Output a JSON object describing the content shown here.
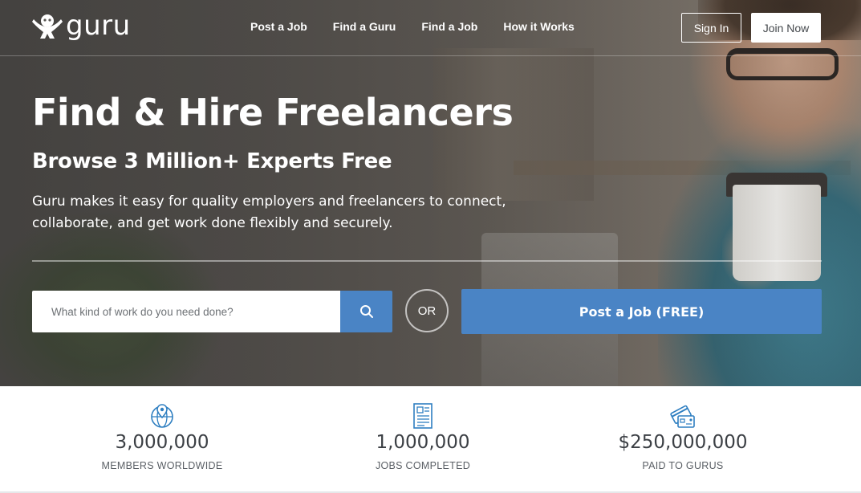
{
  "brand": {
    "logo_text": "guru"
  },
  "nav": {
    "links": [
      {
        "label": "Post a Job"
      },
      {
        "label": "Find a Guru"
      },
      {
        "label": "Find a Job"
      },
      {
        "label": "How it Works"
      }
    ],
    "sign_in": "Sign In",
    "join_now": "Join Now"
  },
  "hero": {
    "title": "Find & Hire Freelancers",
    "subtitle": "Browse 3 Million+ Experts Free",
    "description": "Guru makes it easy for quality employers and freelancers to connect, collaborate, and get work done flexibly and securely.",
    "search": {
      "placeholder": "What kind of work do you need done?",
      "value": ""
    },
    "or_label": "OR",
    "post_job_button": "Post a Job (FREE)"
  },
  "stats": [
    {
      "icon": "globe-pin-icon",
      "value": "3,000,000",
      "label": "MEMBERS WORLDWIDE"
    },
    {
      "icon": "document-icon",
      "value": "1,000,000",
      "label": "JOBS COMPLETED"
    },
    {
      "icon": "credit-card-icon",
      "value": "$250,000,000",
      "label": "PAID TO GURUS"
    }
  ],
  "colors": {
    "accent": "#4a84c5",
    "icon": "#2f7fc1",
    "stat_text": "#3b3f44"
  }
}
